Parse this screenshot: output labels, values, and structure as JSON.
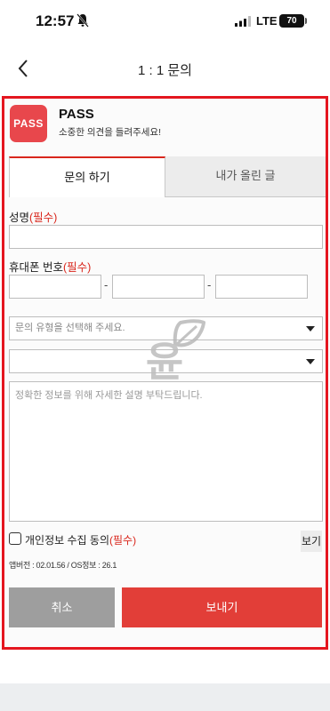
{
  "status_bar": {
    "time": "12:57",
    "network": "LTE",
    "battery": "70"
  },
  "nav": {
    "title": "1 : 1 문의",
    "back_icon": "chevron-left-icon"
  },
  "app": {
    "logo_text": "PASS",
    "name": "PASS",
    "subtitle": "소중한 의견을 들려주세요!"
  },
  "tabs": [
    {
      "label": "문의 하기",
      "active": true
    },
    {
      "label": "내가 올린 글",
      "active": false
    }
  ],
  "form": {
    "name_label": "성명",
    "name_required": "(필수)",
    "phone_label": "휴대폰 번호",
    "phone_required": "(필수)",
    "phone_separator": "-",
    "inquiry_type_placeholder": "문의 유형을 선택해 주세요.",
    "sub_type_value": "",
    "message_placeholder": "정확한 정보를 위해 자세한 설명 부탁드립니다.",
    "consent_label": "개인정보 수집 동의",
    "consent_required": "(필수)",
    "view_label": "보기",
    "version_info": "앱버전 : 02.01.56 / OS정보 : 26.1"
  },
  "buttons": {
    "cancel": "취소",
    "send": "보내기"
  },
  "watermark": {
    "text": "윤"
  },
  "colors": {
    "accent": "#e4161f",
    "logo": "#e8474c",
    "send_button": "#e23e38",
    "cancel_button": "#9e9e9e",
    "required": "#d9261c"
  }
}
